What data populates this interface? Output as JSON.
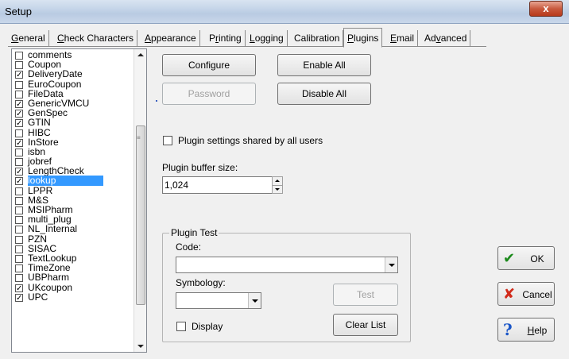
{
  "window": {
    "title": "Setup",
    "close_label": "x"
  },
  "tabs": [
    {
      "label": "General",
      "hotkey": "G",
      "rest": "eneral",
      "active": false
    },
    {
      "label": "Check Characters",
      "hotkey": "C",
      "rest": "heck Characters",
      "active": false
    },
    {
      "label": "Appearance",
      "hotkey": "A",
      "rest": "ppearance",
      "active": false
    },
    {
      "label": "Printing",
      "hotkey": "r",
      "pre": "P",
      "rest": "inting",
      "active": false
    },
    {
      "label": "Logging",
      "hotkey": "L",
      "rest": "ogging",
      "active": false
    },
    {
      "label": "Calibration",
      "plain": "Calibration",
      "active": false
    },
    {
      "label": "Plugins",
      "hotkey": "P",
      "rest": "lugins",
      "active": true
    },
    {
      "label": "Email",
      "hotkey": "E",
      "rest": "mail",
      "active": false
    },
    {
      "label": "Advanced",
      "pre": "Ad",
      "hotkey": "v",
      "rest": "anced",
      "active": false
    }
  ],
  "plugin_list": [
    {
      "label": "comments",
      "checked": false
    },
    {
      "label": "Coupon",
      "checked": false
    },
    {
      "label": "DeliveryDate",
      "checked": true
    },
    {
      "label": "EuroCoupon",
      "checked": false
    },
    {
      "label": "FileData",
      "checked": false
    },
    {
      "label": "GenericVMCU",
      "checked": true
    },
    {
      "label": "GenSpec",
      "checked": true
    },
    {
      "label": "GTIN",
      "checked": true
    },
    {
      "label": "HIBC",
      "checked": false
    },
    {
      "label": "InStore",
      "checked": true
    },
    {
      "label": "isbn",
      "checked": false
    },
    {
      "label": "jobref",
      "checked": false
    },
    {
      "label": "LengthCheck",
      "checked": true
    },
    {
      "label": "lookup",
      "checked": true,
      "selected": true
    },
    {
      "label": "LPPR",
      "checked": false
    },
    {
      "label": "M&S",
      "checked": false
    },
    {
      "label": "MSIPharm",
      "checked": false
    },
    {
      "label": "multi_plug",
      "checked": false
    },
    {
      "label": "NL_Internal",
      "checked": false
    },
    {
      "label": "PZN",
      "checked": false
    },
    {
      "label": "SISAC",
      "checked": false
    },
    {
      "label": "TextLookup",
      "checked": false
    },
    {
      "label": "TimeZone",
      "checked": false
    },
    {
      "label": "UBPharm",
      "checked": false
    },
    {
      "label": "UKcoupon",
      "checked": true
    },
    {
      "label": "UPC",
      "checked": true
    }
  ],
  "buttons": {
    "configure": "Configure",
    "enable_all": "Enable All",
    "password": "Password",
    "disable_all": "Disable All",
    "test": "Test",
    "clear_list": "Clear List"
  },
  "shared_checkbox": {
    "label": "Plugin settings shared by all users",
    "checked": false
  },
  "buffer": {
    "label": "Plugin buffer size:",
    "value": "1,024"
  },
  "plugin_test": {
    "legend": "Plugin Test",
    "code_label": "Code:",
    "code_value": "",
    "symbology_label": "Symbology:",
    "symbology_value": "",
    "display_label": "Display",
    "display_checked": false
  },
  "side_buttons": {
    "ok": "OK",
    "cancel": "Cancel",
    "help_pre": "",
    "help_hotkey": "H",
    "help_rest": "elp"
  },
  "icons": {
    "ok": "check-icon",
    "cancel": "x-icon",
    "help": "question-icon"
  },
  "colors": {
    "selection": "#3399ff",
    "ok_icon": "#1c8a1c",
    "cancel_icon": "#d12a1a",
    "help_icon": "#1a56c8"
  }
}
